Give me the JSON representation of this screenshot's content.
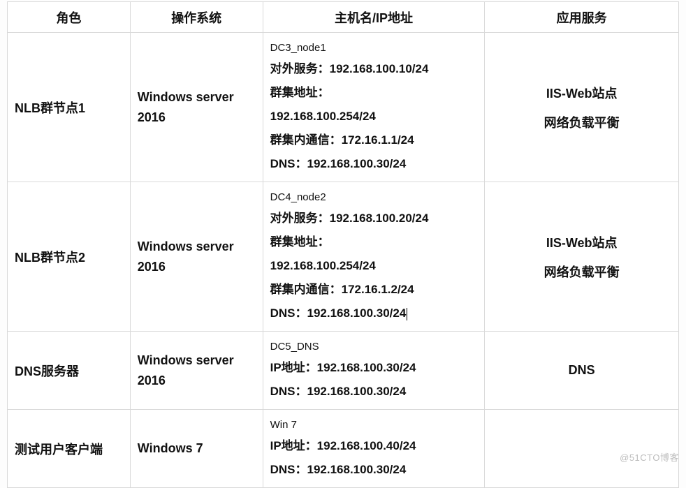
{
  "headers": {
    "role": "角色",
    "os": "操作系统",
    "host": "主机名/IP地址",
    "svc": "应用服务"
  },
  "rows": [
    {
      "role": "NLB群节点1",
      "os_l1": "Windows server",
      "os_l2": "2016",
      "host_name": "DC3_node1",
      "host_lines": [
        "对外服务：192.168.100.10/24",
        "群集地址：",
        "192.168.100.254/24",
        "群集内通信：172.16.1.1/24",
        "DNS：192.168.100.30/24"
      ],
      "svc1": "IIS-Web站点",
      "svc2": "网络负载平衡"
    },
    {
      "role": "NLB群节点2",
      "os_l1": "Windows server",
      "os_l2": "2016",
      "host_name": "DC4_node2",
      "host_lines": [
        "对外服务：192.168.100.20/24",
        "群集地址：",
        "192.168.100.254/24",
        "群集内通信：172.16.1.2/24",
        "DNS：192.168.100.30/24"
      ],
      "svc1": "IIS-Web站点",
      "svc2": "网络负载平衡",
      "cursor_after_last": true
    },
    {
      "role": "DNS服务器",
      "os_l1": "Windows server",
      "os_l2": "2016",
      "host_name": "DC5_DNS",
      "host_lines": [
        "IP地址：192.168.100.30/24",
        "DNS：192.168.100.30/24"
      ],
      "svc1": "DNS",
      "svc2": ""
    },
    {
      "role": "测试用户客户端",
      "os_l1": "Windows 7",
      "os_l2": "",
      "host_name": "Win 7",
      "host_lines": [
        "IP地址：192.168.100.40/24",
        "DNS：192.168.100.30/24"
      ],
      "svc1": "",
      "svc2": ""
    }
  ],
  "watermark": "@51CTO博客"
}
